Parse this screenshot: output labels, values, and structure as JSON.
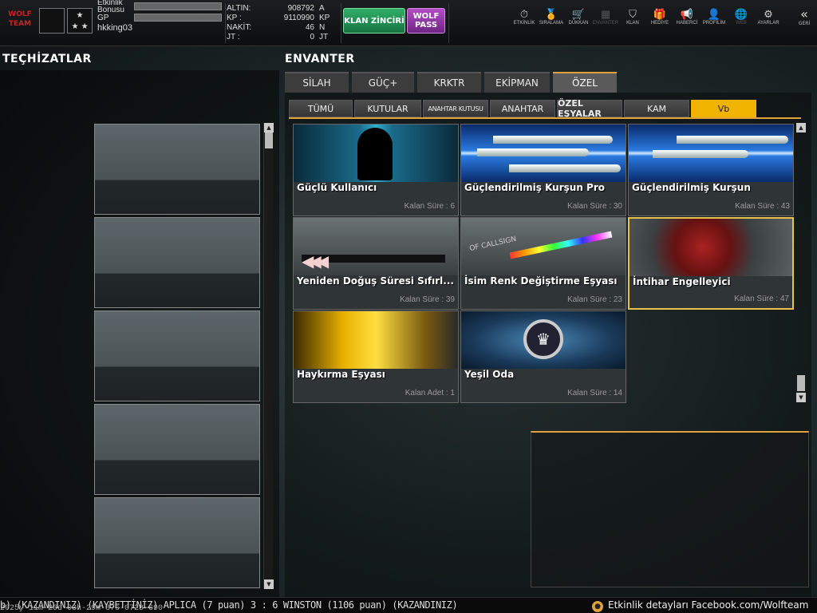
{
  "header": {
    "etkinlik_label": "Etkinlik Bonusu",
    "gp_label": "GP",
    "username": "hkking03",
    "currency": [
      {
        "label": "ALTIN:",
        "value": "908792",
        "unit": "A"
      },
      {
        "label": "KP :",
        "value": "9110990",
        "unit": "KP"
      },
      {
        "label": "NAKİT:",
        "value": "46",
        "unit": "N"
      },
      {
        "label": "JT :",
        "value": "0",
        "unit": "JT"
      }
    ],
    "klan_button": "KLAN ZİNCİRİ",
    "wolf_button": "WOLF PASS",
    "nav": [
      {
        "label": "ETKİNLİK",
        "icon": "stopwatch-icon",
        "glyph": "⏱"
      },
      {
        "label": "SIRALAMA",
        "icon": "medal-icon",
        "glyph": "🏅"
      },
      {
        "label": "DÜKKAN",
        "icon": "cart-icon",
        "glyph": "🛒"
      },
      {
        "label": "ENVANTER",
        "icon": "inventory-icon",
        "glyph": "▦"
      },
      {
        "label": "KLAN",
        "icon": "shield-icon",
        "glyph": "⛉"
      },
      {
        "label": "HEDİYE",
        "icon": "gift-icon",
        "glyph": "🎁"
      },
      {
        "label": "HABERCİ",
        "icon": "megaphone-icon",
        "glyph": "📢"
      },
      {
        "label": "PROFİLİM",
        "icon": "profile-icon",
        "glyph": "👤"
      },
      {
        "label": "WEB",
        "icon": "globe-icon",
        "glyph": "🌐"
      },
      {
        "label": "AYARLAR",
        "icon": "gear-icon",
        "glyph": "⚙"
      }
    ],
    "back_label": "GERİ"
  },
  "left": {
    "title": "TEÇHİZATLAR"
  },
  "inventory": {
    "title": "ENVANTER",
    "main_tabs": [
      "SİLAH",
      "GÜÇ+",
      "KRKTR",
      "EKİPMAN",
      "ÖZEL"
    ],
    "active_main_tab": "ÖZEL",
    "sub_tabs": [
      "TÜMÜ",
      "KUTULAR",
      "ANAHTAR KUTUSU",
      "ANAHTAR",
      "ÖZEL EŞYALAR",
      "KAM",
      "Vb"
    ],
    "active_sub_tab": "Vb",
    "items": [
      {
        "name": "Güçlü Kullanıcı",
        "sub": "Kalan Süre : 6"
      },
      {
        "name": "Güçlendirilmiş Kurşun Pro",
        "sub": "Kalan Süre : 30"
      },
      {
        "name": "Güçlendirilmiş Kurşun",
        "sub": "Kalan Süre : 43"
      },
      {
        "name": "Yeniden Doğuş Süresi Sıfırl...",
        "sub": "Kalan Süre : 39"
      },
      {
        "name": "İsim Renk Değiştirme Eşyası",
        "sub": "Kalan Süre : 23"
      },
      {
        "name": "İntihar Engelleyici",
        "sub": "Kalan Süre : 47"
      },
      {
        "name": "Haykırma Eşyası",
        "sub": "Kalan Adet : 1"
      },
      {
        "name": "Yeşil Oda",
        "sub": "Kalan Süre : 14"
      }
    ],
    "selected_item": "İntihar Engelleyici",
    "callsign_art_text": "OF CALLSIGN"
  },
  "ticker": {
    "message": "b) (KAZANDINIZ)        (KAYBETTİNİZ) APLICA (7 puan) 3 : 6 WINSTON (1106 puan) (KAZANDINIZ)",
    "timestamp": "2025y-11m-26d-03h-29m-37s-0728-690",
    "info": "Etkinlik detayları Facebook.com/Wolfteam"
  }
}
